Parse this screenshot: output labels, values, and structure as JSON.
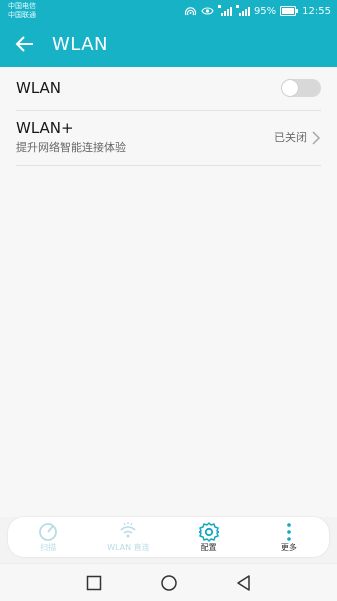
{
  "status_bar": {
    "carrier_top": "中国电信",
    "carrier_bottom": "中国联通",
    "battery": "95%",
    "time": "12:55",
    "icons": [
      "hotspot-icon",
      "eye-comfort-icon",
      "signal-4g-icon",
      "signal-4g-icon",
      "battery-icon"
    ]
  },
  "header": {
    "title": "WLAN",
    "back_icon": "back-arrow-icon"
  },
  "settings": {
    "wlan": {
      "label": "WLAN",
      "enabled": false
    },
    "wlan_plus": {
      "label": "WLAN+",
      "subtitle": "提升网络智能连接体验",
      "status": "已关闭"
    }
  },
  "toolbar": {
    "items": [
      {
        "label": "扫描",
        "icon": "scan-icon",
        "state": "disabled"
      },
      {
        "label": "WLAN 直连",
        "icon": "wifi-direct-icon",
        "state": "disabled"
      },
      {
        "label": "配置",
        "icon": "gear-icon",
        "state": "active"
      },
      {
        "label": "更多",
        "icon": "more-vertical-icon",
        "state": "active"
      }
    ]
  },
  "nav_bar": {
    "buttons": [
      "square-icon",
      "circle-icon",
      "triangle-back-icon"
    ]
  },
  "colors": {
    "header": "#18b2c7",
    "accent": "#14a8c0",
    "background": "#f7f7f7"
  }
}
